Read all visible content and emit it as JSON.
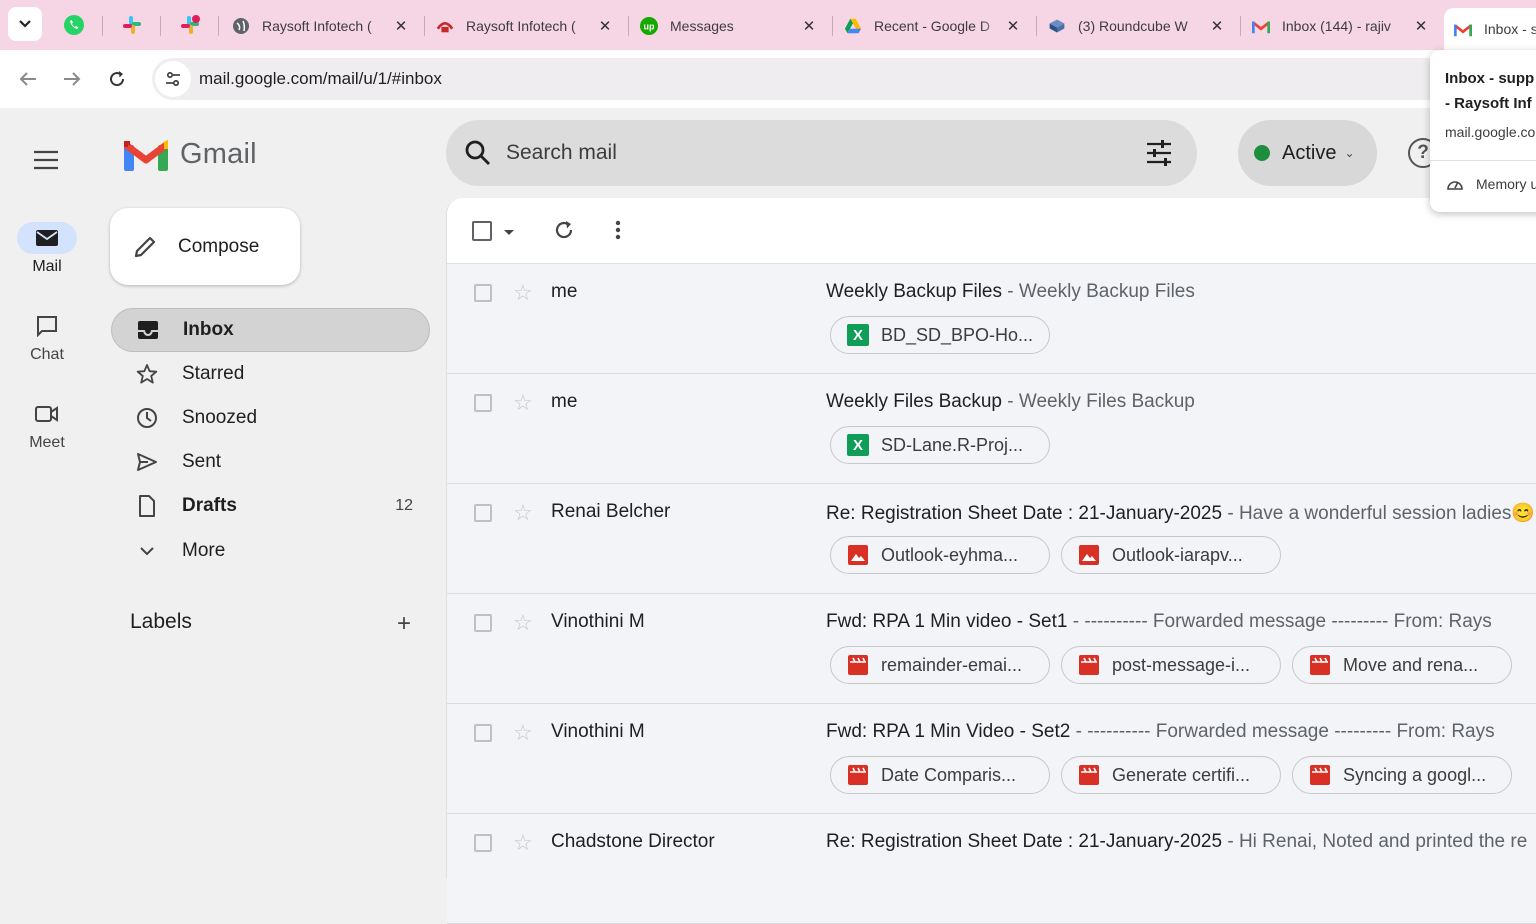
{
  "tabs": [
    {
      "title": "Raysoft Infotech (",
      "icon": "globe-icon"
    },
    {
      "title": "Raysoft Infotech (",
      "icon": "raysoft-icon"
    },
    {
      "title": "Messages",
      "icon": "upwork-icon"
    },
    {
      "title": "Recent - Google D",
      "icon": "google-drive-icon"
    },
    {
      "title": "(3) Roundcube W",
      "icon": "roundcube-icon"
    },
    {
      "title": "Inbox (144) - rajiv",
      "icon": "gmail-icon"
    },
    {
      "title": "Inbox - s",
      "icon": "gmail-icon",
      "active": true
    }
  ],
  "pinned_tabs": [
    "whatsapp-icon",
    "slack-icon",
    "slack-icon"
  ],
  "address": {
    "url": "mail.google.com/mail/u/1/#inbox"
  },
  "tab_popup": {
    "title_line1": "Inbox - supp",
    "title_line2": "- Raysoft Inf",
    "url": "mail.google.co",
    "memory": "Memory u"
  },
  "rail": {
    "mail": "Mail",
    "chat": "Chat",
    "meet": "Meet"
  },
  "brand": {
    "name": "Gmail"
  },
  "compose": {
    "label": "Compose"
  },
  "nav": {
    "inbox": "Inbox",
    "starred": "Starred",
    "snoozed": "Snoozed",
    "sent": "Sent",
    "drafts": "Drafts",
    "drafts_count": "12",
    "more": "More"
  },
  "labels": {
    "title": "Labels"
  },
  "search": {
    "placeholder": "Search mail"
  },
  "status": {
    "label": "Active",
    "color": "#1e8e3e"
  },
  "help": {
    "label": "?"
  },
  "emails": [
    {
      "sender": "me",
      "subject": "Weekly Backup Files",
      "snippet": " - Weekly Backup Files",
      "attachments": [
        {
          "name": "BD_SD_BPO-Ho...",
          "type": "excel"
        }
      ]
    },
    {
      "sender": "me",
      "subject": "Weekly Files Backup",
      "snippet": " - Weekly Files Backup",
      "attachments": [
        {
          "name": "SD-Lane.R-Proj...",
          "type": "excel"
        }
      ]
    },
    {
      "sender": "Renai Belcher",
      "subject": "Re: Registration Sheet Date : 21-January-2025",
      "snippet": " - Have a wonderful session ladies😊",
      "attachments": [
        {
          "name": "Outlook-eyhma...",
          "type": "image"
        },
        {
          "name": "Outlook-iarapv...",
          "type": "image"
        }
      ]
    },
    {
      "sender": "Vinothini M",
      "subject": "Fwd: RPA 1 Min video - Set1",
      "snippet": " - ---------- Forwarded message --------- From: Rays",
      "attachments": [
        {
          "name": "remainder-emai...",
          "type": "video"
        },
        {
          "name": "post-message-i...",
          "type": "video"
        },
        {
          "name": "Move and rena...",
          "type": "video"
        }
      ]
    },
    {
      "sender": "Vinothini M",
      "subject": "Fwd: RPA 1 Min Video - Set2",
      "snippet": " - ---------- Forwarded message --------- From: Rays",
      "attachments": [
        {
          "name": "Date Comparis...",
          "type": "video"
        },
        {
          "name": "Generate certifi...",
          "type": "video"
        },
        {
          "name": "Syncing a googl...",
          "type": "video"
        }
      ]
    },
    {
      "sender": "Chadstone Director",
      "subject": "Re: Registration Sheet Date : 21-January-2025",
      "snippet": " - Hi Renai, Noted and printed the re",
      "attachments": []
    }
  ]
}
